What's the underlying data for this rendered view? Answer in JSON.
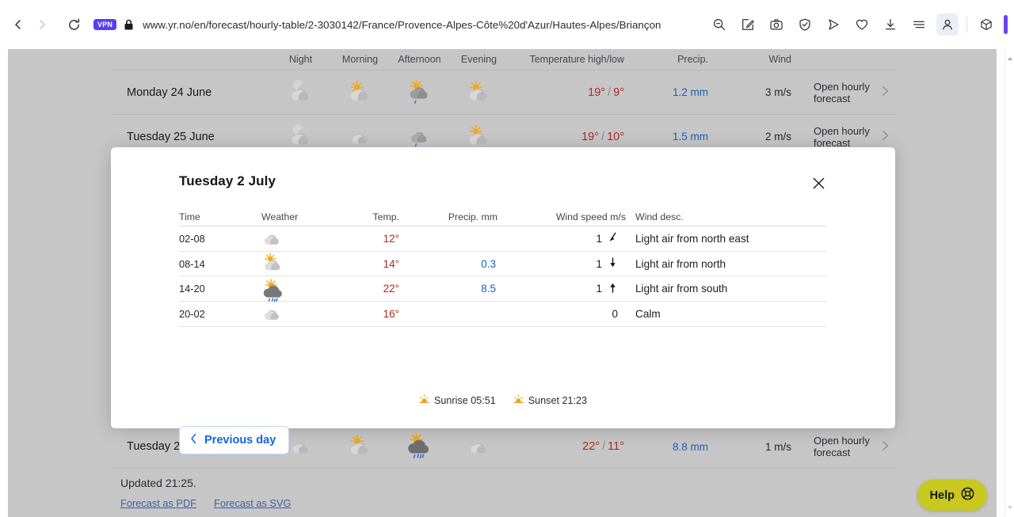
{
  "browser": {
    "back_label": "Back",
    "forward_label": "Forward",
    "reload_label": "Reload",
    "vpn_badge": "VPN",
    "url": "www.yr.no/en/forecast/hourly-table/2-3030142/France/Provence-Alpes-Côte%20d'Azur/Hautes-Alpes/Briançon",
    "toolbar_icons": [
      "zoom-out-icon",
      "annotate-icon",
      "screenshot-icon",
      "shield-icon",
      "send-icon",
      "favorite-icon",
      "download-icon",
      "reader-settings-icon",
      "profile-icon",
      "extension-cube-icon"
    ]
  },
  "forecast_table": {
    "headers": {
      "day": "",
      "night": "Night",
      "morning": "Morning",
      "afternoon": "Afternoon",
      "evening": "Evening",
      "temperature": "Temperature high/low",
      "precip": "Precip.",
      "wind": "Wind",
      "open": ""
    },
    "rows": [
      {
        "day": "Monday 24 June",
        "icons": [
          "moon-cloud-icon",
          "sun-cloud-icon",
          "sun-cloud-rain-icon",
          "sun-cloud-icon"
        ],
        "temp_high": "19°",
        "temp_sep": "/",
        "temp_low": "9°",
        "precip": "1.2 mm",
        "wind": "3 m/s",
        "open_label": "Open hourly forecast"
      },
      {
        "day": "Tuesday 25 June",
        "icons": [
          "moon-cloud-icon",
          "cloud-icon",
          "cloud-rain-icon",
          "sun-cloud-icon"
        ],
        "temp_high": "19°",
        "temp_sep": "/",
        "temp_low": "10°",
        "precip": "1.5 mm",
        "wind": "2 m/s",
        "open_label": "Open hourly forecast"
      },
      {
        "day": "Tuesday 2 July",
        "icons": [
          "cloud-icon",
          "sun-cloud-icon",
          "sun-cloud-rain-icon",
          "cloud-icon"
        ],
        "temp_high": "22°",
        "temp_sep": "/",
        "temp_low": "11°",
        "precip": "8.8 mm",
        "wind": "1 m/s",
        "open_label": "Open hourly forecast"
      }
    ]
  },
  "footer": {
    "updated": "Updated 21:25.",
    "pdf_link": "Forecast as PDF",
    "svg_link": "Forecast as SVG"
  },
  "modal": {
    "title": "Tuesday 2 July",
    "close_label": "Close",
    "headers": {
      "time": "Time",
      "weather": "Weather",
      "temp": "Temp.",
      "precip": "Precip. mm",
      "wind_speed": "Wind speed m/s",
      "wind_desc": "Wind desc."
    },
    "rows": [
      {
        "time": "02-08",
        "icon": "cloud-icon",
        "temp": "12°",
        "precip": "",
        "wind_speed": "1",
        "wind_arrow": "arrow-down-left-icon",
        "wind_desc": "Light air from north east"
      },
      {
        "time": "08-14",
        "icon": "sun-cloud-icon",
        "temp": "14°",
        "precip": "0.3",
        "wind_speed": "1",
        "wind_arrow": "arrow-down-icon",
        "wind_desc": "Light air from north"
      },
      {
        "time": "14-20",
        "icon": "sun-cloud-rain-icon",
        "temp": "22°",
        "precip": "8.5",
        "wind_speed": "1",
        "wind_arrow": "arrow-up-icon",
        "wind_desc": "Light air from south"
      },
      {
        "time": "20-02",
        "icon": "cloud-icon",
        "temp": "16°",
        "precip": "",
        "wind_speed": "0",
        "wind_arrow": "",
        "wind_desc": "Calm"
      }
    ],
    "sunrise": "Sunrise 05:51",
    "sunset": "Sunset 21:23",
    "previous_day": "Previous day"
  },
  "help": {
    "label": "Help"
  },
  "colors": {
    "accent_blue": "#1266e0",
    "temp_red": "#b0291f",
    "precip_blue": "#1b5fb8",
    "vpn_purple": "#5b3df5",
    "help_yellow": "#c8c81e",
    "page_bg": "#c6c6c6"
  }
}
